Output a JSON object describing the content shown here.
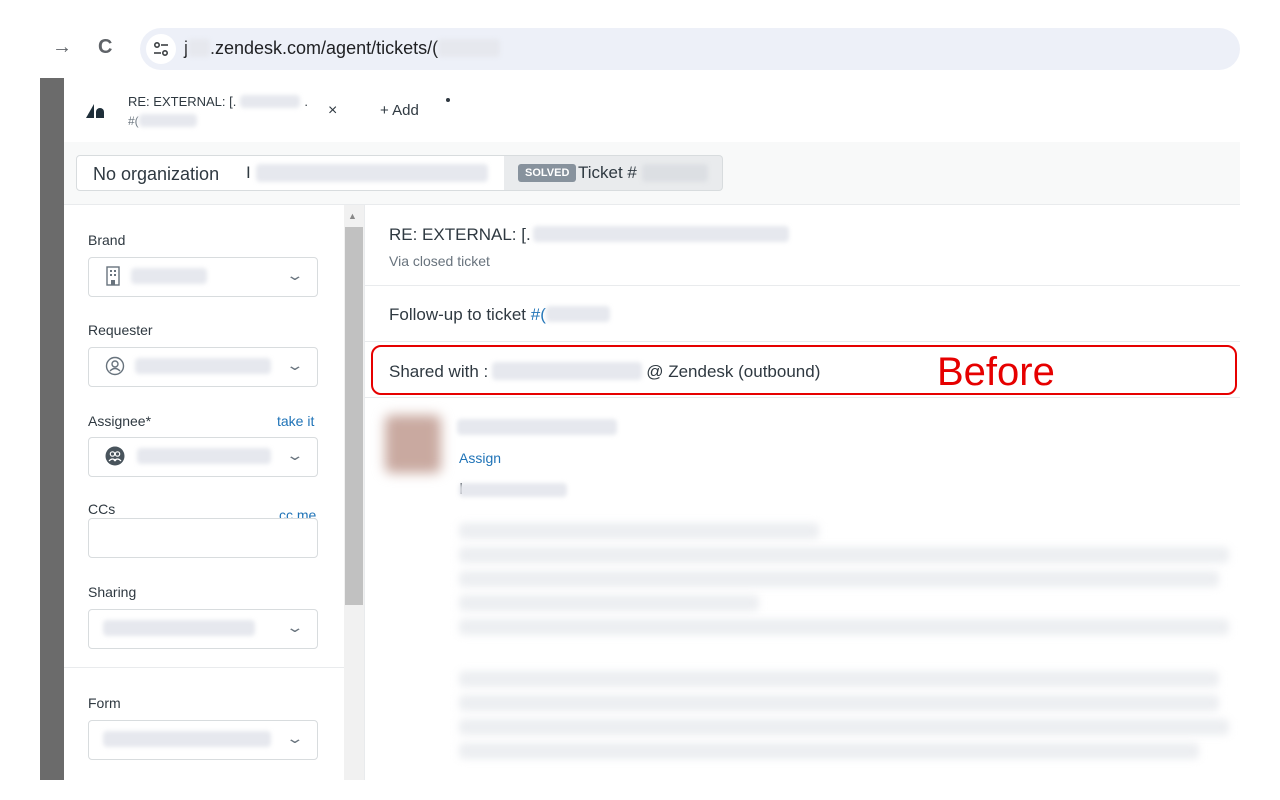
{
  "browser": {
    "url_prefix": "j",
    "url_domain": ".zendesk.com/agent/tickets/(",
    "forward_icon": "→",
    "reload_icon": "C"
  },
  "tab": {
    "title": "RE: EXTERNAL: [.",
    "title_suffix": ".",
    "subtitle": "#(",
    "close": "×",
    "add_label": "+ Add"
  },
  "context": {
    "organization": "No organization",
    "requester_initial": "I",
    "status_badge": "SOLVED",
    "ticket_label": "Ticket #"
  },
  "sidebar": {
    "brand_label": "Brand",
    "requester_label": "Requester",
    "assignee_label": "Assignee*",
    "take_it": "take it",
    "ccs_label": "CCs",
    "cc_me": "cc me",
    "sharing_label": "Sharing",
    "form_label": "Form",
    "chevron": "⌄"
  },
  "main": {
    "subject": "RE: EXTERNAL: [.",
    "via": "Via closed ticket",
    "followup_text": "Follow-up to ticket ",
    "followup_link": "#(",
    "shared_prefix": "Shared with :",
    "shared_suffix": "@ Zendesk (outbound)",
    "annotation": "Before",
    "assign": "Assign",
    "greeting_initial": "I"
  },
  "colors": {
    "accent_link": "#1f73b7",
    "annotation_red": "#e60000",
    "solved_badge": "#87929d"
  }
}
